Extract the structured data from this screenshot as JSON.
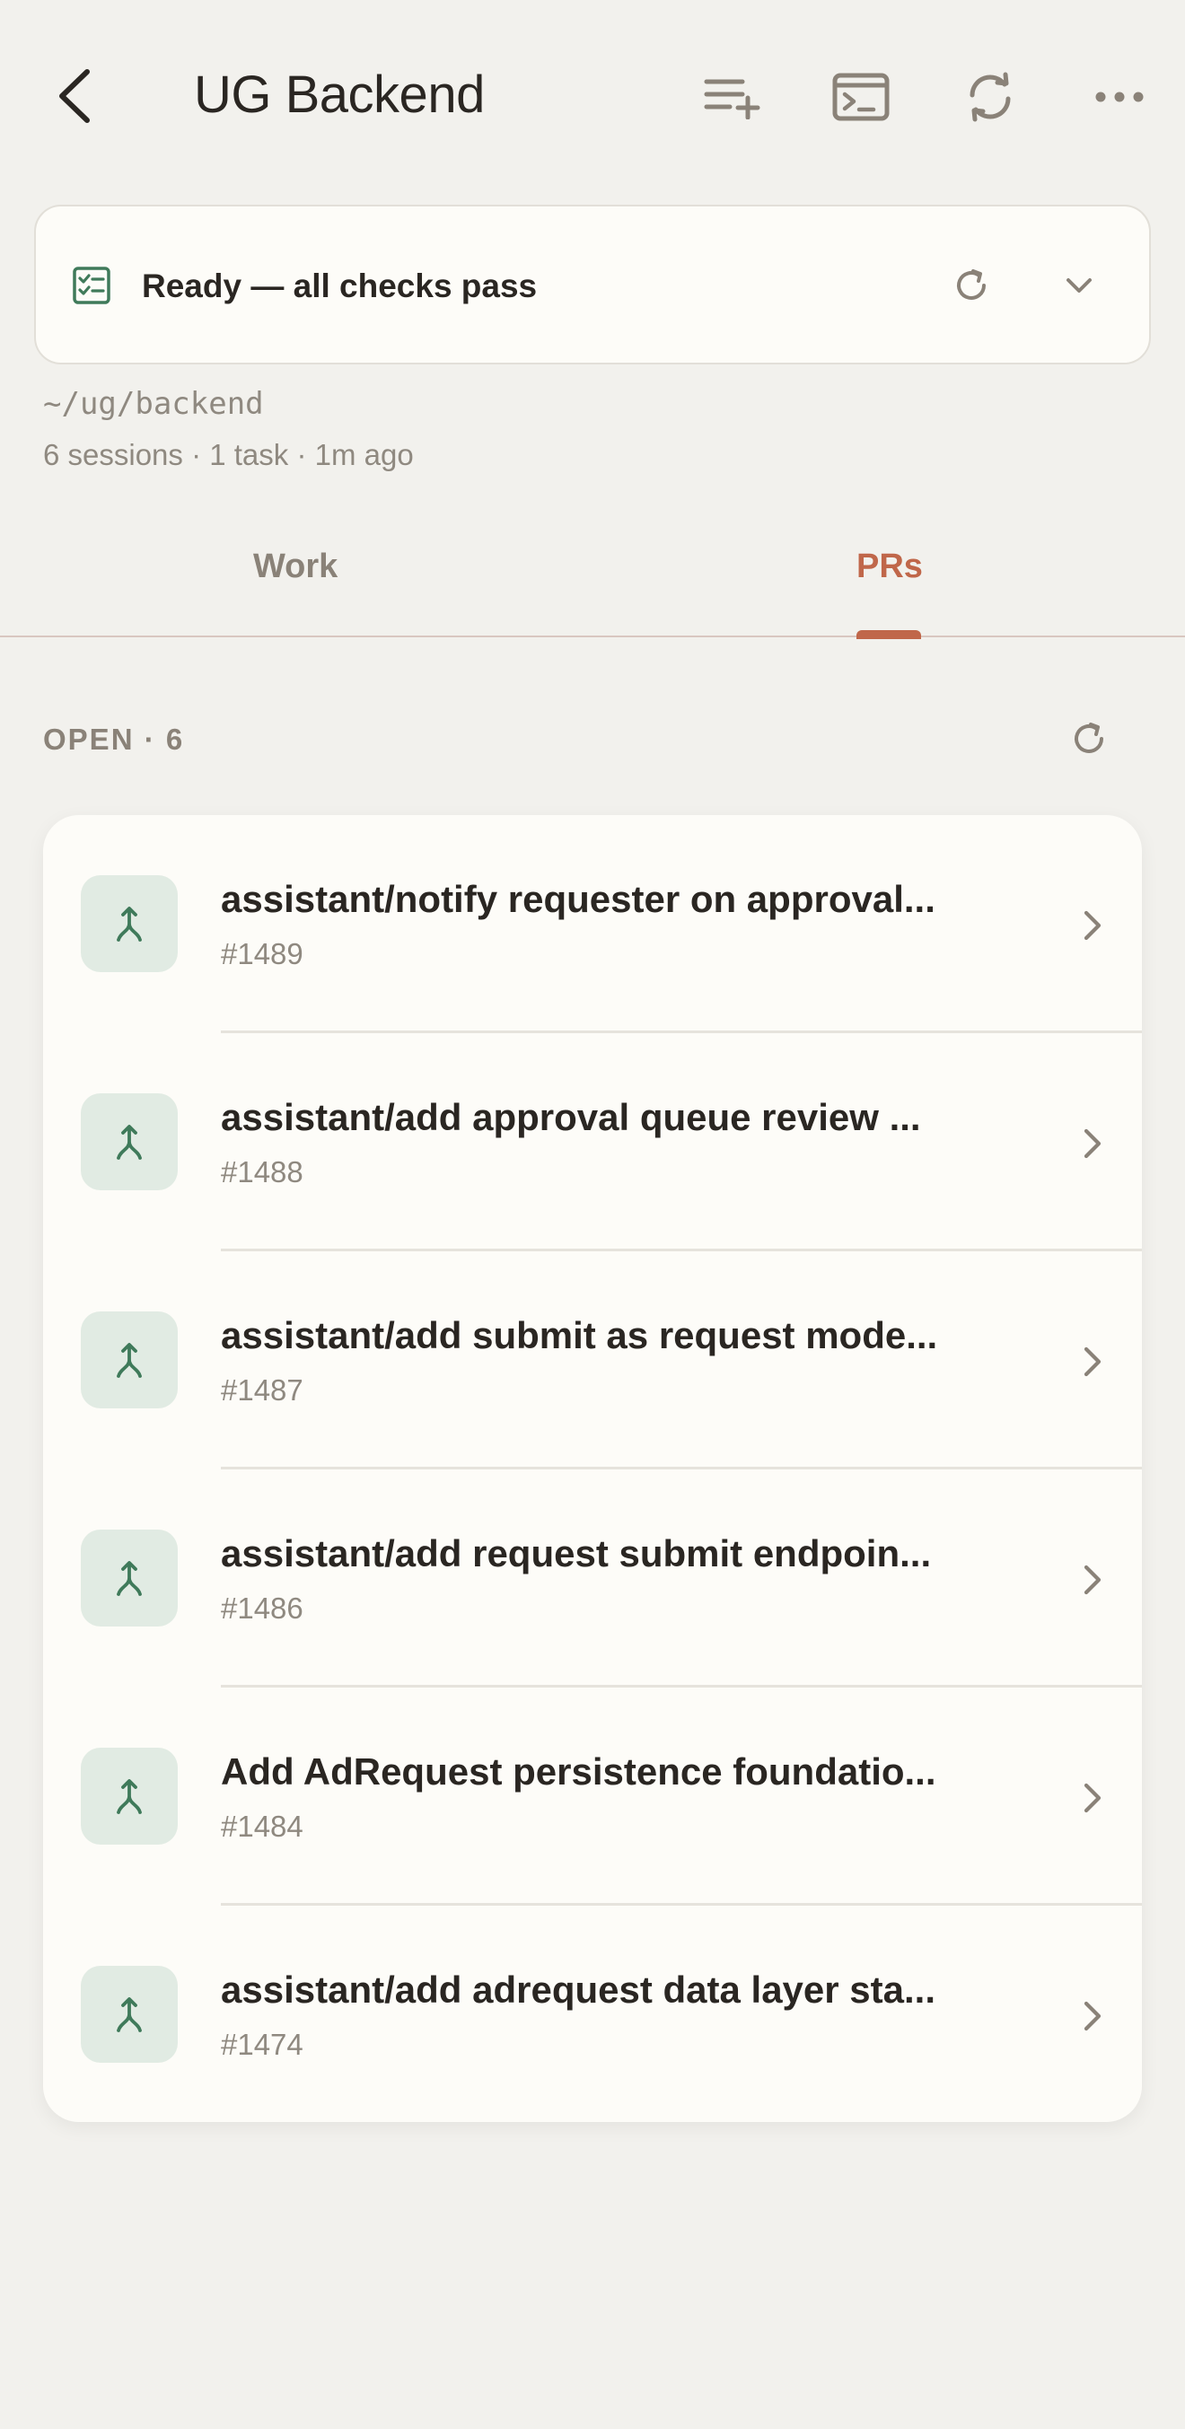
{
  "header": {
    "title": "UG Backend",
    "icons": [
      "back-chevron-icon",
      "add-to-queue-icon",
      "terminal-icon",
      "sync-icon",
      "more-icon"
    ]
  },
  "status": {
    "text": "Ready — all checks pass",
    "icon": "checklist-icon",
    "accent": "#3f7a5a"
  },
  "repo": {
    "path": "~/ug/backend",
    "meta": "6 sessions · 1 task · 1m ago"
  },
  "tabs": [
    {
      "label": "Work",
      "active": false
    },
    {
      "label": "PRs",
      "active": true
    }
  ],
  "section": {
    "label": "OPEN · 6"
  },
  "colors": {
    "accent": "#c0674a",
    "pr_icon": "#3f7a5a",
    "pr_icon_bg": "#e1ebe3",
    "background": "#f2f1ed",
    "card": "#fdfcf8"
  },
  "prs": [
    {
      "title": "assistant/notify requester on approval...",
      "number": "#1489"
    },
    {
      "title": "assistant/add approval queue review ...",
      "number": "#1488"
    },
    {
      "title": "assistant/add submit as request mode...",
      "number": "#1487"
    },
    {
      "title": "assistant/add request submit endpoin...",
      "number": "#1486"
    },
    {
      "title": "Add AdRequest persistence foundatio...",
      "number": "#1484"
    },
    {
      "title": "assistant/add adrequest data layer sta...",
      "number": "#1474"
    }
  ]
}
